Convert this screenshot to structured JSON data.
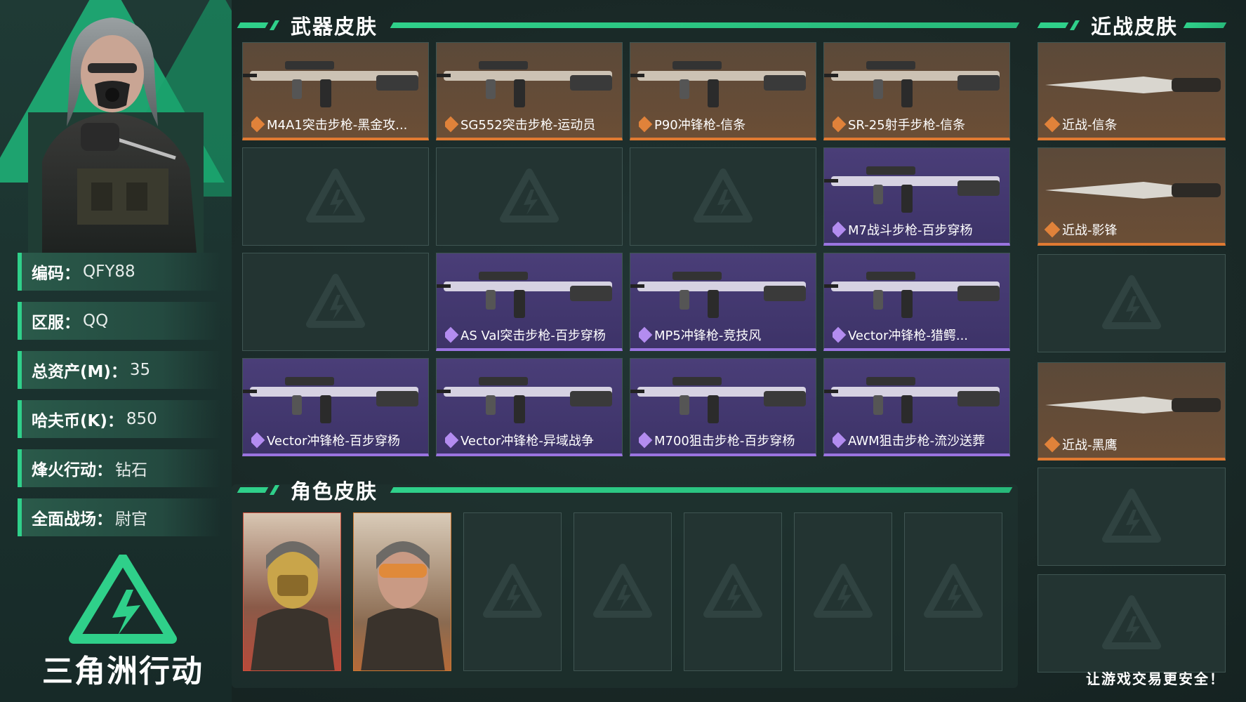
{
  "profile": {
    "rows": [
      {
        "key": "编码",
        "value": "QFY88"
      },
      {
        "key": "区服",
        "value": "QQ"
      },
      {
        "key": "总资产(M)",
        "value": "35"
      },
      {
        "key": "哈夫币(K)",
        "value": "850"
      },
      {
        "key": "烽火行动",
        "value": "钻石"
      },
      {
        "key": "全面战场",
        "value": "尉官"
      }
    ]
  },
  "logo": {
    "title": "三角洲行动"
  },
  "sections": {
    "weapon_title": "武器皮肤",
    "melee_title": "近战皮肤",
    "character_title": "角色皮肤"
  },
  "weapons": [
    {
      "label": "M4A1突击步枪-黑金攻...",
      "rarity": "orange"
    },
    {
      "label": "SG552突击步枪-运动员",
      "rarity": "orange"
    },
    {
      "label": "P90冲锋枪-信条",
      "rarity": "orange"
    },
    {
      "label": "SR-25射手步枪-信条",
      "rarity": "orange"
    },
    {
      "label": "",
      "rarity": "empty"
    },
    {
      "label": "",
      "rarity": "empty"
    },
    {
      "label": "",
      "rarity": "empty"
    },
    {
      "label": "M7战斗步枪-百步穿杨",
      "rarity": "purple"
    },
    {
      "label": "",
      "rarity": "empty"
    },
    {
      "label": "AS Val突击步枪-百步穿杨",
      "rarity": "purple"
    },
    {
      "label": "MP5冲锋枪-竞技风",
      "rarity": "purple"
    },
    {
      "label": "Vector冲锋枪-猎鳄...",
      "rarity": "purple"
    },
    {
      "label": "Vector冲锋枪-百步穿杨",
      "rarity": "purple"
    },
    {
      "label": "Vector冲锋枪-异域战争",
      "rarity": "purple"
    },
    {
      "label": "M700狙击步枪-百步穿杨",
      "rarity": "purple"
    },
    {
      "label": "AWM狙击步枪-流沙送葬",
      "rarity": "purple"
    }
  ],
  "melee": [
    {
      "label": "近战-信条",
      "rarity": "orange"
    },
    {
      "label": "近战-影锋",
      "rarity": "orange"
    },
    {
      "label": "",
      "rarity": "empty"
    },
    {
      "label": "近战-黑鹰",
      "rarity": "orange"
    },
    {
      "label": "",
      "rarity": "empty"
    },
    {
      "label": "",
      "rarity": "empty"
    }
  ],
  "characters": [
    {
      "skin": "gold-mask",
      "rarity": "red"
    },
    {
      "skin": "goggles",
      "rarity": "orange"
    },
    {
      "skin": "",
      "rarity": "empty"
    },
    {
      "skin": "",
      "rarity": "empty"
    },
    {
      "skin": "",
      "rarity": "empty"
    },
    {
      "skin": "",
      "rarity": "empty"
    },
    {
      "skin": "",
      "rarity": "empty"
    }
  ],
  "slogan": "让游戏交易更安全！",
  "colors": {
    "accent": "#2fd08a",
    "orange": "#e07a32",
    "purple": "#9a74e0"
  }
}
